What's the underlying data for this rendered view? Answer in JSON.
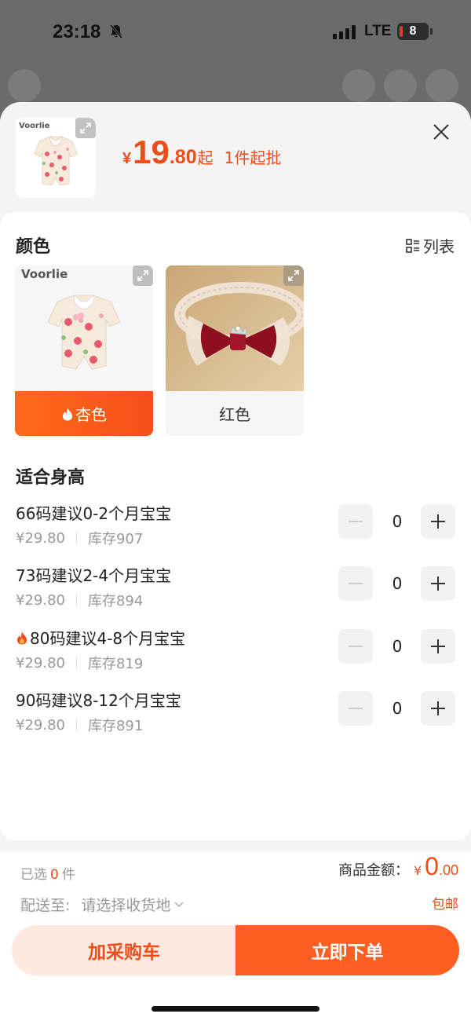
{
  "status": {
    "time": "23:18",
    "network": "LTE",
    "battery": "8"
  },
  "product": {
    "brand_mark": "Voorlie",
    "price_currency": "¥",
    "price_int": "19",
    "price_dec": ".80",
    "price_suffix": "起",
    "moq": "1件起批"
  },
  "color_section": {
    "title": "颜色",
    "list_toggle": "列表",
    "options": [
      {
        "label": "杏色",
        "selected": true,
        "hot": true
      },
      {
        "label": "红色",
        "selected": false,
        "hot": false
      }
    ]
  },
  "size_section": {
    "title": "适合身高",
    "items": [
      {
        "name": "66码建议0-2个月宝宝",
        "price": "¥29.80",
        "stock": "库存907",
        "qty": "0",
        "hot": false
      },
      {
        "name": "73码建议2-4个月宝宝",
        "price": "¥29.80",
        "stock": "库存894",
        "qty": "0",
        "hot": false
      },
      {
        "name": "80码建议4-8个月宝宝",
        "price": "¥29.80",
        "stock": "库存819",
        "qty": "0",
        "hot": true
      },
      {
        "name": "90码建议8-12个月宝宝",
        "price": "¥29.80",
        "stock": "库存891",
        "qty": "0",
        "hot": false
      }
    ]
  },
  "footer": {
    "selected_prefix": "已选",
    "selected_count": "0",
    "selected_unit": "件",
    "amount_label": "商品金额：",
    "amount_currency": "¥",
    "amount_int": "0",
    "amount_dec": ".00",
    "ship_label": "配送至:",
    "ship_placeholder": "请选择收货地",
    "free_shipping": "包邮",
    "add_to_cart": "加采购车",
    "buy_now": "立即下单"
  },
  "colors": {
    "accent": "#ee4d1a",
    "accent_button": "#ff5e22",
    "cart_button_bg": "#fde9e0"
  }
}
